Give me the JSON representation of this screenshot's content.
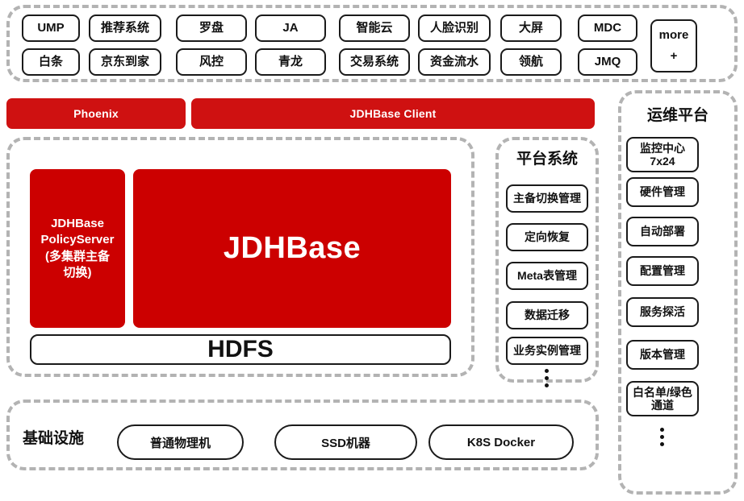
{
  "theme": {
    "red_block": "#cc0000",
    "red_bar": "#cf1111",
    "dashed_border": "#b3b3b3",
    "box_border": "#1a1a1a",
    "text": "#111111",
    "background": "#ffffff"
  },
  "applications": {
    "row1": [
      {
        "label": "UMP"
      },
      {
        "label": "推荐系统"
      },
      {
        "label": "罗盘"
      },
      {
        "label": "JA"
      },
      {
        "label": "智能云"
      },
      {
        "label": "人脸识别"
      },
      {
        "label": "大屏"
      },
      {
        "label": "MDC"
      }
    ],
    "row2": [
      {
        "label": "白条"
      },
      {
        "label": "京东到家"
      },
      {
        "label": "风控"
      },
      {
        "label": "青龙"
      },
      {
        "label": "交易系统"
      },
      {
        "label": "资金流水"
      },
      {
        "label": "领航"
      },
      {
        "label": "JMQ"
      }
    ],
    "more": {
      "label": "more",
      "plus": "+"
    }
  },
  "access_layer": {
    "phoenix": "Phoenix",
    "client": "JDHBase Client"
  },
  "core": {
    "policy_server": "JDHBase\nPolicyServer\n(多集群主备\n切换)",
    "policy_server_lines": [
      "JDHBase",
      "PolicyServer",
      "(多集群主备",
      "切换)"
    ],
    "engine": "JDHBase",
    "storage": "HDFS"
  },
  "platform_system": {
    "title": "平台系统",
    "items": [
      {
        "label": "主备切换管理"
      },
      {
        "label": "定向恢复"
      },
      {
        "label": "Meta表管理"
      },
      {
        "label": "数据迁移"
      },
      {
        "label": "业务实例管理"
      }
    ],
    "has_more_indicator": true
  },
  "ops_platform": {
    "title": "运维平台",
    "items": [
      {
        "label": "监控中心\n7x24",
        "lines": [
          "监控中心",
          "7x24"
        ]
      },
      {
        "label": "硬件管理",
        "lines": [
          "硬件管理"
        ]
      },
      {
        "label": "自动部署",
        "lines": [
          "自动部署"
        ]
      },
      {
        "label": "配置管理",
        "lines": [
          "配置管理"
        ]
      },
      {
        "label": "服务探活",
        "lines": [
          "服务探活"
        ]
      },
      {
        "label": "版本管理",
        "lines": [
          "版本管理"
        ]
      },
      {
        "label": "白名单/绿色\n通道",
        "lines": [
          "白名单/绿色",
          "通道"
        ]
      }
    ],
    "has_more_indicator": true
  },
  "infrastructure": {
    "title": "基础设施",
    "items": [
      {
        "label": "普通物理机"
      },
      {
        "label": "SSD机器"
      },
      {
        "label": "K8S Docker"
      }
    ]
  }
}
